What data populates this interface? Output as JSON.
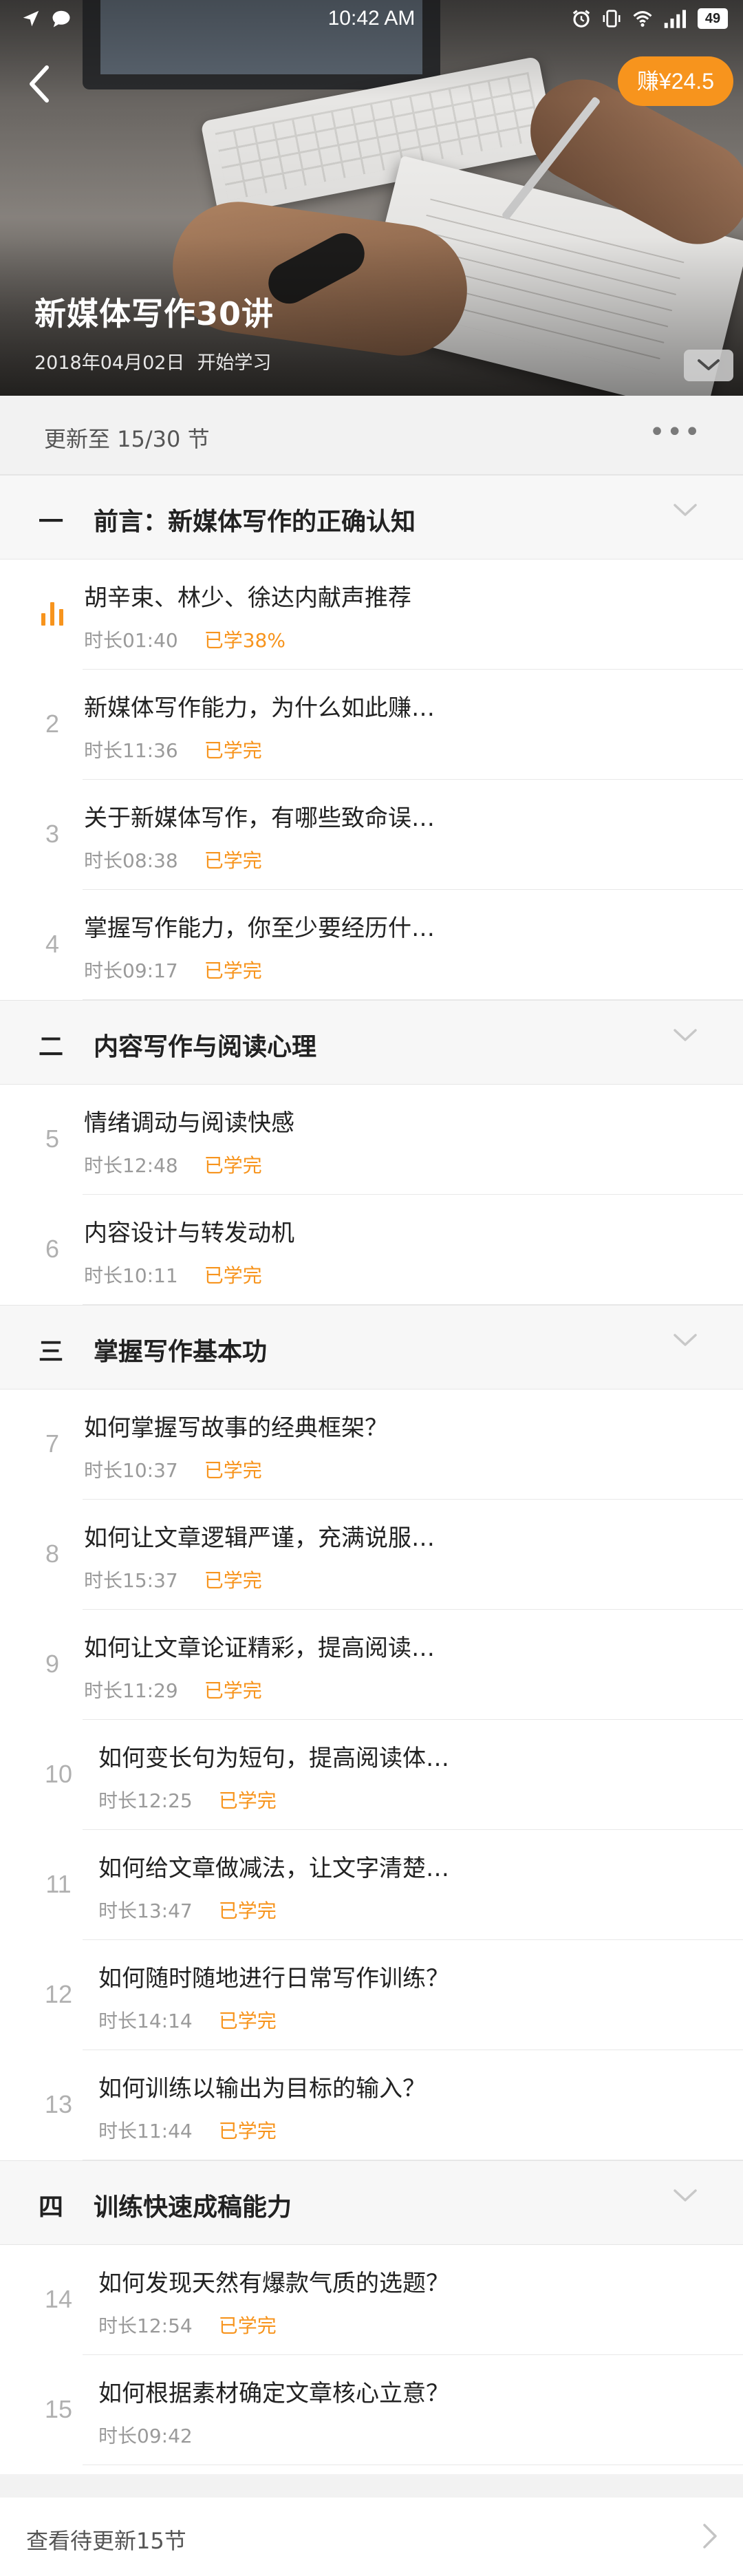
{
  "status_bar": {
    "time": "10:42 AM",
    "battery": "49",
    "left_icons": [
      "navigation-icon",
      "chat-icon"
    ],
    "right_icons": [
      "alarm-icon",
      "vibrate-icon",
      "wifi-icon",
      "signal-icon"
    ]
  },
  "header": {
    "earn_label": "赚¥24.5",
    "course_title": "新媒体写作30讲",
    "start_date": "2018年04月02日",
    "start_label": "开始学习"
  },
  "progress": {
    "update_label": "更新至 15/30 节",
    "more_label": "•••"
  },
  "colors": {
    "accent": "#f7941d",
    "title_text": "#222222",
    "meta_text": "#9a9a9a"
  },
  "sections": [
    {
      "num": "一",
      "title": "前言：新媒体写作的正确认知",
      "lessons": [
        {
          "index": "",
          "title": "胡辛束、林少、徐达内献声推荐",
          "duration": "时长01:40",
          "status": "已学38%",
          "playing": true
        },
        {
          "index": "2",
          "title": "新媒体写作能力，为什么如此赚…",
          "duration": "时长11:36",
          "status": "已学完"
        },
        {
          "index": "3",
          "title": "关于新媒体写作，有哪些致命误…",
          "duration": "时长08:38",
          "status": "已学完"
        },
        {
          "index": "4",
          "title": "掌握写作能力，你至少要经历什…",
          "duration": "时长09:17",
          "status": "已学完"
        }
      ]
    },
    {
      "num": "二",
      "title": "内容写作与阅读心理",
      "lessons": [
        {
          "index": "5",
          "title": "情绪调动与阅读快感",
          "duration": "时长12:48",
          "status": "已学完"
        },
        {
          "index": "6",
          "title": "内容设计与转发动机",
          "duration": "时长10:11",
          "status": "已学完"
        }
      ]
    },
    {
      "num": "三",
      "title": "掌握写作基本功",
      "lessons": [
        {
          "index": "7",
          "title": "如何掌握写故事的经典框架？",
          "duration": "时长10:37",
          "status": "已学完"
        },
        {
          "index": "8",
          "title": "如何让文章逻辑严谨，充满说服…",
          "duration": "时长15:37",
          "status": "已学完"
        },
        {
          "index": "9",
          "title": "如何让文章论证精彩，提高阅读…",
          "duration": "时长11:29",
          "status": "已学完"
        },
        {
          "index": "10",
          "title": "如何变长句为短句，提高阅读体…",
          "duration": "时长12:25",
          "status": "已学完"
        },
        {
          "index": "11",
          "title": "如何给文章做减法，让文字清楚…",
          "duration": "时长13:47",
          "status": "已学完"
        },
        {
          "index": "12",
          "title": "如何随时随地进行日常写作训练？",
          "duration": "时长14:14",
          "status": "已学完"
        },
        {
          "index": "13",
          "title": "如何训练以输出为目标的输入？",
          "duration": "时长11:44",
          "status": "已学完"
        }
      ]
    },
    {
      "num": "四",
      "title": "训练快速成稿能力",
      "lessons": [
        {
          "index": "14",
          "title": "如何发现天然有爆款气质的选题？",
          "duration": "时长12:54",
          "status": "已学完"
        },
        {
          "index": "15",
          "title": "如何根据素材确定文章核心立意？",
          "duration": "时长09:42",
          "status": ""
        }
      ]
    }
  ],
  "footer": {
    "pending_label": "查看待更新15节"
  }
}
